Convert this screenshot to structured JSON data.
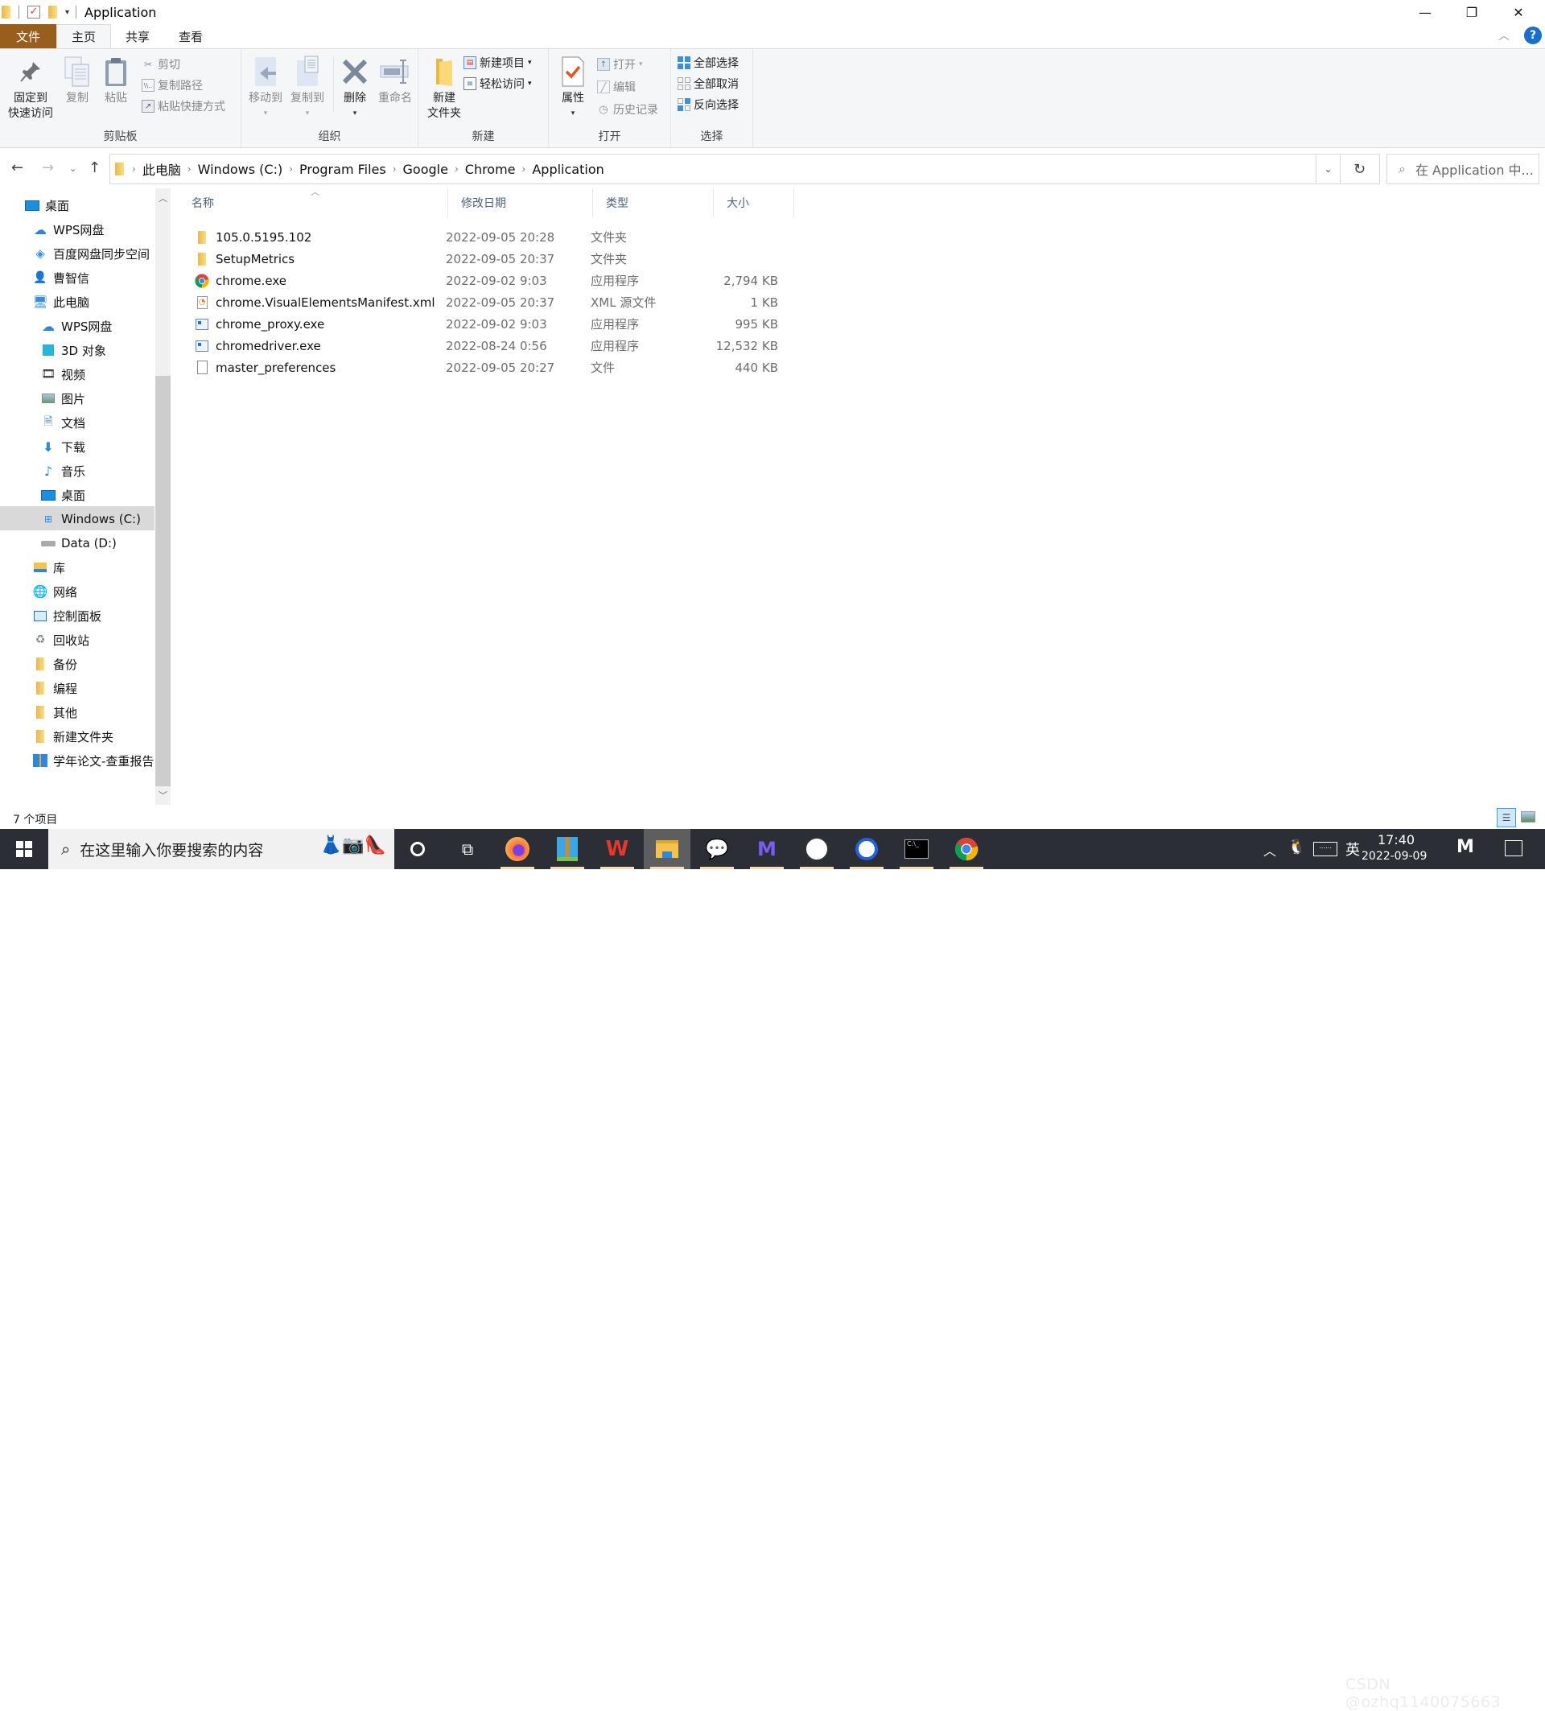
{
  "window": {
    "title": "Application",
    "controls": {
      "minimize": "—",
      "restore": "❐",
      "close": "✕"
    }
  },
  "ribbon_tabs": [
    {
      "label": "文件"
    },
    {
      "label": "主页"
    },
    {
      "label": "共享"
    },
    {
      "label": "查看"
    }
  ],
  "ribbon": {
    "clipboard": {
      "group_label": "剪贴板",
      "pin_quick_access": "固定到\n快速访问",
      "pin_line1": "固定到",
      "pin_line2": "快速访问",
      "copy": "复制",
      "paste": "粘贴",
      "cut": "剪切",
      "copy_path": "复制路径",
      "paste_shortcut": "粘贴快捷方式"
    },
    "organize": {
      "group_label": "组织",
      "move_to": "移动到",
      "copy_to": "复制到",
      "delete": "删除",
      "rename": "重命名"
    },
    "new": {
      "group_label": "新建",
      "new_folder_line1": "新建",
      "new_folder_line2": "文件夹",
      "new_item": "新建项目",
      "easy_access": "轻松访问"
    },
    "open": {
      "group_label": "打开",
      "properties": "属性",
      "open": "打开",
      "edit": "编辑",
      "history": "历史记录"
    },
    "select": {
      "group_label": "选择",
      "select_all": "全部选择",
      "select_none": "全部取消",
      "invert_selection": "反向选择"
    }
  },
  "address": {
    "breadcrumbs": [
      "此电脑",
      "Windows (C:)",
      "Program Files",
      "Google",
      "Chrome",
      "Application"
    ],
    "search_placeholder": "在 Application 中..."
  },
  "nav_pane": {
    "items": [
      {
        "label": "桌面",
        "icon": "desktop-icon"
      },
      {
        "label": "WPS网盘",
        "icon": "cloud-icon"
      },
      {
        "label": "百度网盘同步空间",
        "icon": "baidu-netdisk-icon"
      },
      {
        "label": "曹智信",
        "icon": "user-folder-icon"
      },
      {
        "label": "此电脑",
        "icon": "this-pc-icon"
      },
      {
        "label": "WPS网盘",
        "icon": "cloud-icon"
      },
      {
        "label": "3D 对象",
        "icon": "3d-objects-icon"
      },
      {
        "label": "视频",
        "icon": "videos-icon"
      },
      {
        "label": "图片",
        "icon": "pictures-icon"
      },
      {
        "label": "文档",
        "icon": "documents-icon"
      },
      {
        "label": "下载",
        "icon": "downloads-icon"
      },
      {
        "label": "音乐",
        "icon": "music-icon"
      },
      {
        "label": "桌面",
        "icon": "desktop-icon"
      },
      {
        "label": "Windows (C:)",
        "icon": "drive-c-icon",
        "selected": true
      },
      {
        "label": "Data (D:)",
        "icon": "drive-d-icon"
      },
      {
        "label": "库",
        "icon": "libraries-icon"
      },
      {
        "label": "网络",
        "icon": "network-icon"
      },
      {
        "label": "控制面板",
        "icon": "control-panel-icon"
      },
      {
        "label": "回收站",
        "icon": "recycle-bin-icon"
      },
      {
        "label": "备份",
        "icon": "folder-icon"
      },
      {
        "label": "编程",
        "icon": "folder-icon"
      },
      {
        "label": "其他",
        "icon": "folder-icon"
      },
      {
        "label": "新建文件夹",
        "icon": "folder-icon"
      },
      {
        "label": "学年论文-查重报告",
        "icon": "archive-folder-icon"
      }
    ]
  },
  "file_list": {
    "columns": [
      "名称",
      "修改日期",
      "类型",
      "大小"
    ],
    "sort_column": "名称",
    "rows": [
      {
        "name": "105.0.5195.102",
        "date": "2022-09-05 20:28",
        "type": "文件夹",
        "size": "",
        "icon": "folder-icon"
      },
      {
        "name": "SetupMetrics",
        "date": "2022-09-05 20:37",
        "type": "文件夹",
        "size": "",
        "icon": "folder-icon"
      },
      {
        "name": "chrome.exe",
        "date": "2022-09-02 9:03",
        "type": "应用程序",
        "size": "2,794 KB",
        "icon": "chrome-icon"
      },
      {
        "name": "chrome.VisualElementsManifest.xml",
        "date": "2022-09-05 20:37",
        "type": "XML 源文件",
        "size": "1 KB",
        "icon": "xml-file-icon"
      },
      {
        "name": "chrome_proxy.exe",
        "date": "2022-09-02 9:03",
        "type": "应用程序",
        "size": "995 KB",
        "icon": "exe-icon"
      },
      {
        "name": "chromedriver.exe",
        "date": "2022-08-24 0:56",
        "type": "应用程序",
        "size": "12,532 KB",
        "icon": "exe-icon"
      },
      {
        "name": "master_preferences",
        "date": "2022-09-05 20:27",
        "type": "文件",
        "size": "440 KB",
        "icon": "file-icon"
      }
    ]
  },
  "status_bar": {
    "item_count": "7 个项目"
  },
  "taskbar": {
    "search_placeholder": "在这里输入你要搜索的内容",
    "apps": [
      "firefox",
      "winrar",
      "wps-office",
      "file-explorer",
      "wechat",
      "app-purple",
      "avatar-app",
      "app-blue",
      "terminal",
      "chrome"
    ],
    "active_app": "file-explorer",
    "ime": "英",
    "time": "17:40",
    "date": "2022-09-09"
  },
  "watermark": "CSDN @ozhq1140075663"
}
